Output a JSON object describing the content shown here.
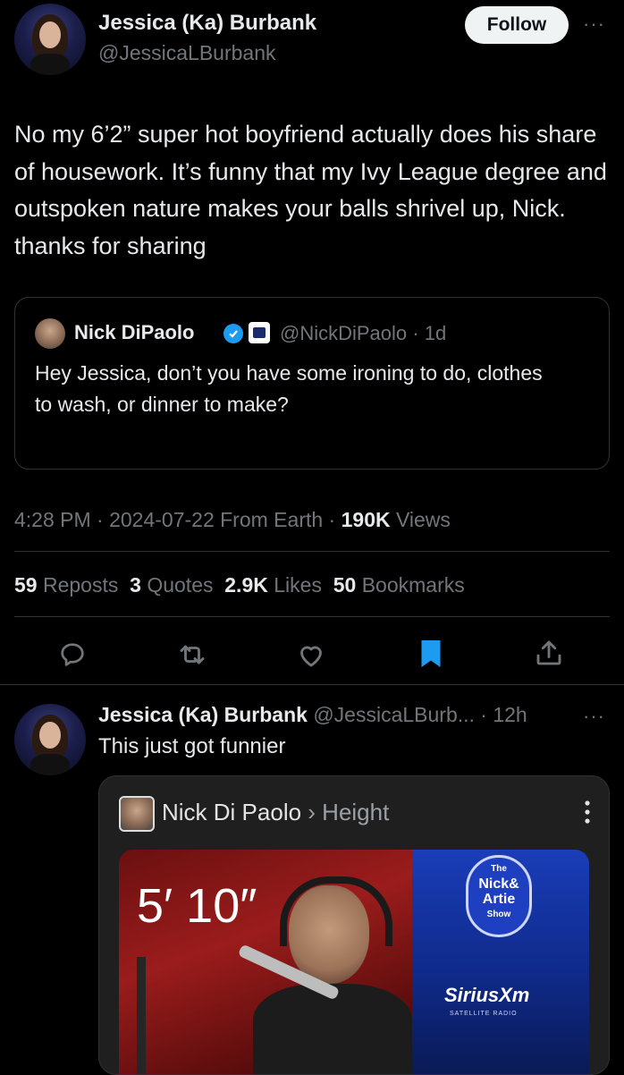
{
  "main_tweet": {
    "author_name": "Jessica (Ka) Burbank",
    "handle": "@JessicaLBurbank",
    "follow_label": "Follow",
    "more_label": "···",
    "text": "No my 6’2” super hot boyfriend actually does his share of housework. It’s funny that my Ivy League degree and outspoken nature makes your balls shrivel up, Nick. thanks for sharing",
    "quote": {
      "author_name": "Nick DiPaolo",
      "handle_time": "@NickDiPaolo · 1d",
      "text": "Hey Jessica, don’t you have some ironing to do, clothes to wash, or dinner to make?"
    },
    "meta": {
      "time_date": "4:28 PM · 2024-07-22 From Earth · ",
      "views_count": "190K",
      "views_label": " Views"
    },
    "stats": {
      "reposts_count": "59",
      "reposts_label": " Reposts",
      "quotes_count": "3",
      "quotes_label": " Quotes",
      "likes_count": "2.9K",
      "likes_label": " Likes",
      "bookmarks_count": "50",
      "bookmarks_label": " Bookmarks"
    },
    "actions": [
      "reply-icon",
      "repost-icon",
      "like-icon",
      "bookmark-icon",
      "share-icon"
    ]
  },
  "reply_tweet": {
    "author_name": "Jessica (Ka) Burbank",
    "handle_time": " @JessicaLBurb... · 12h",
    "more_label": "···",
    "text": "This just got funnier",
    "card": {
      "title": "Nick Di Paolo",
      "separator": " › ",
      "subtitle": "Height",
      "height_value": "5′ 10″",
      "logo_the": "The",
      "logo_line1": "Nick&",
      "logo_line2": "Artie",
      "logo_line3": "Show",
      "sirius_label": "SiriusXm",
      "sirius_sub": "SATELLITE RADIO"
    }
  },
  "colors": {
    "background": "#000000",
    "text": "#e7e9ea",
    "muted": "#71767b",
    "accent": "#1d9bf0",
    "divider": "#2f3336"
  }
}
